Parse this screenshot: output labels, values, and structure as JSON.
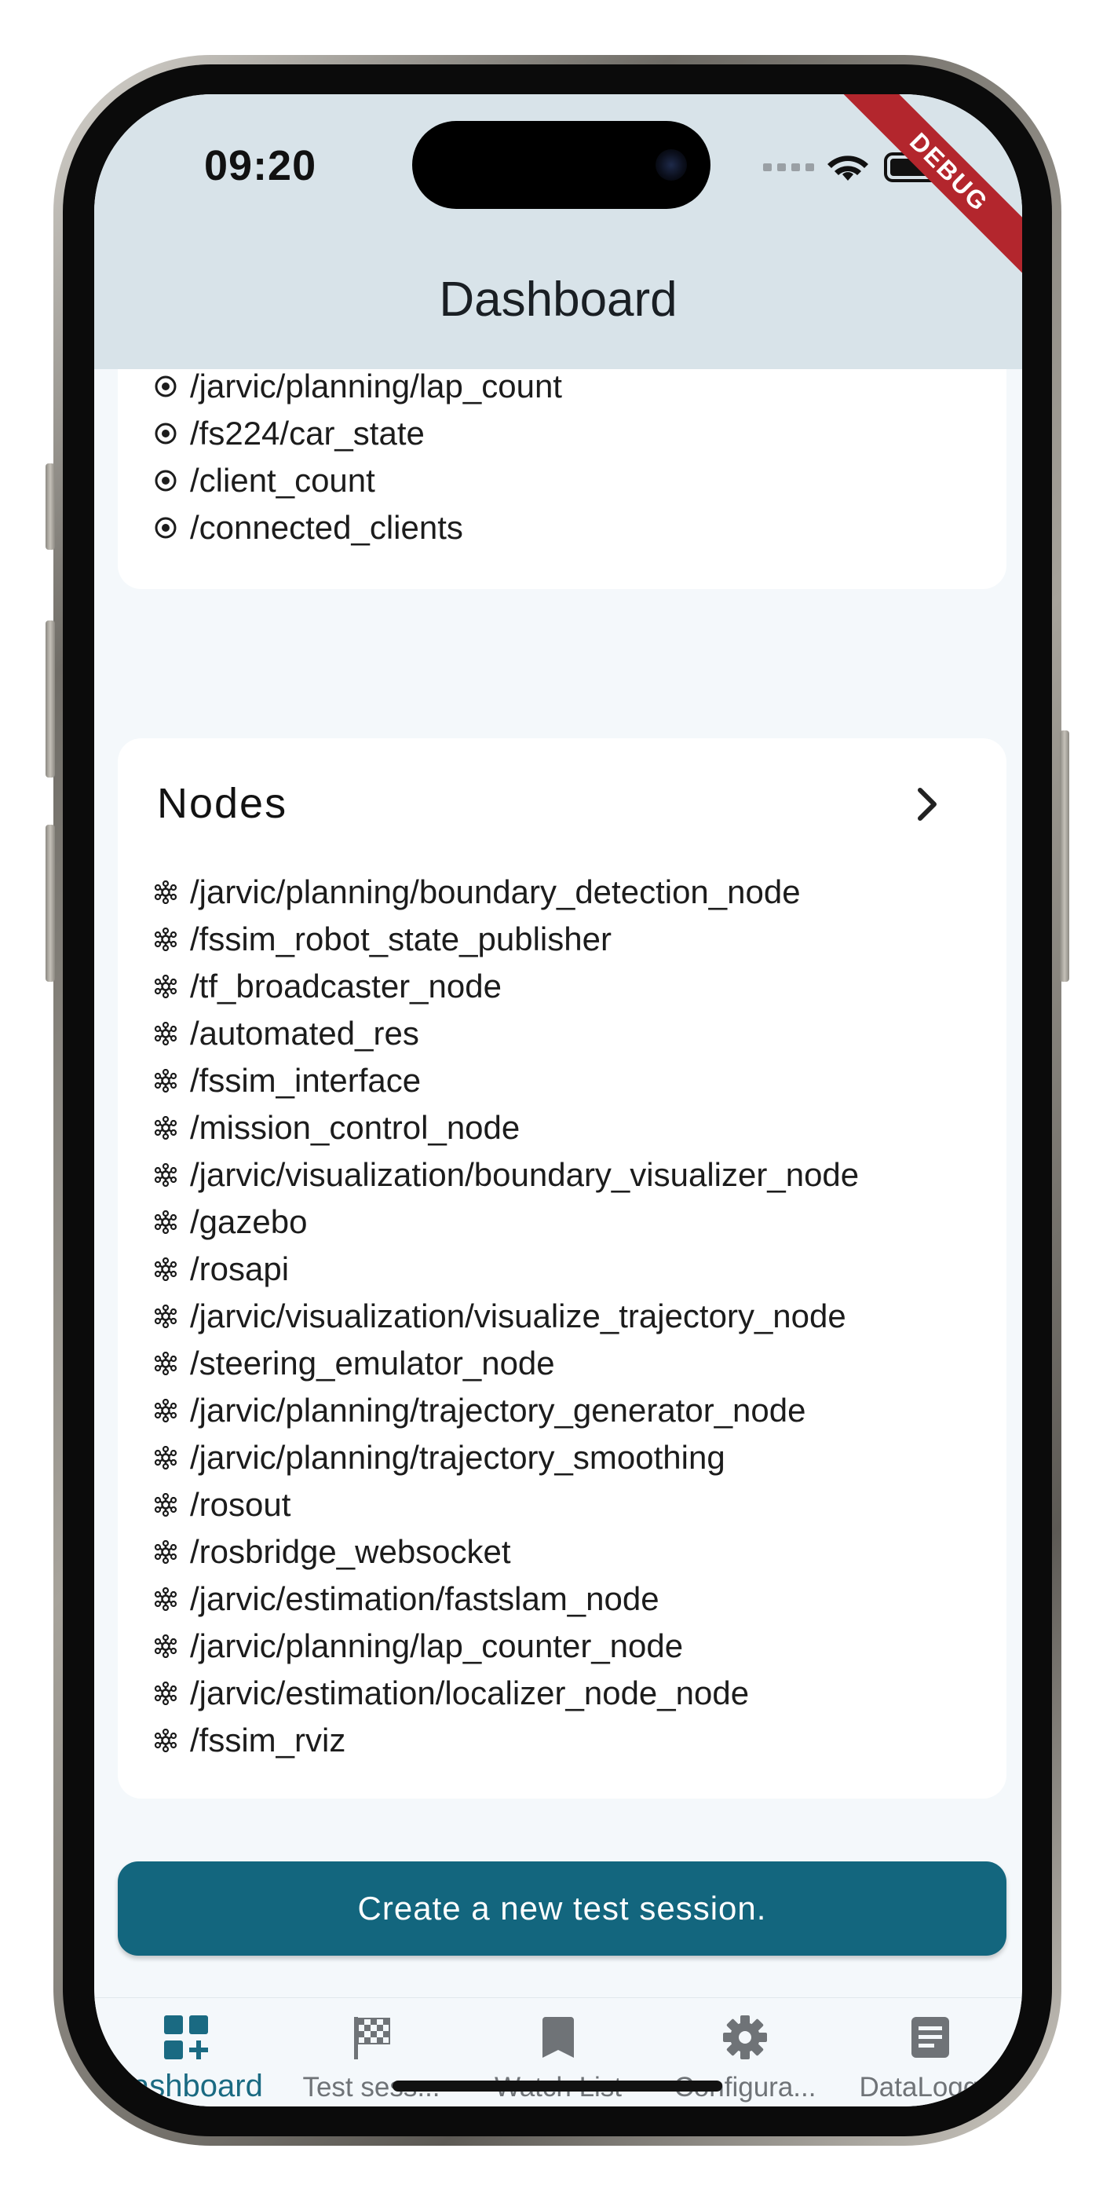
{
  "status_bar": {
    "time": "09:20",
    "debug_banner": "DEBUG"
  },
  "app_bar": {
    "title": "Dashboard"
  },
  "topics": {
    "items": [
      "/jarvic/planning/lap_count",
      "/fs224/car_state",
      "/client_count",
      "/connected_clients"
    ]
  },
  "nodes": {
    "title": "Nodes",
    "items": [
      "/jarvic/planning/boundary_detection_node",
      "/fssim_robot_state_publisher",
      "/tf_broadcaster_node",
      "/automated_res",
      "/fssim_interface",
      "/mission_control_node",
      "/jarvic/visualization/boundary_visualizer_node",
      "/gazebo",
      "/rosapi",
      "/jarvic/visualization/visualize_trajectory_node",
      "/steering_emulator_node",
      "/jarvic/planning/trajectory_generator_node",
      "/jarvic/planning/trajectory_smoothing",
      "/rosout",
      "/rosbridge_websocket",
      "/jarvic/estimation/fastslam_node",
      "/jarvic/planning/lap_counter_node",
      "/jarvic/estimation/localizer_node_node",
      "/fssim_rviz"
    ]
  },
  "actions": {
    "create_session": "Create a new test session."
  },
  "bottom_nav": {
    "items": [
      {
        "label": "Dashboard",
        "icon": "dashboard-customize-icon",
        "active": true
      },
      {
        "label": "Test sess...",
        "icon": "checkered-flag-icon",
        "active": false
      },
      {
        "label": "Watch List",
        "icon": "bookmark-icon",
        "active": false
      },
      {
        "label": "Configura...",
        "icon": "gear-icon",
        "active": false
      },
      {
        "label": "DataLogg...",
        "icon": "article-icon",
        "active": false
      }
    ]
  },
  "colors": {
    "primary": "#13667e",
    "active_nav": "#1a6a82",
    "header_bg": "#d8e3e9",
    "debug_banner": "#b3262d"
  }
}
